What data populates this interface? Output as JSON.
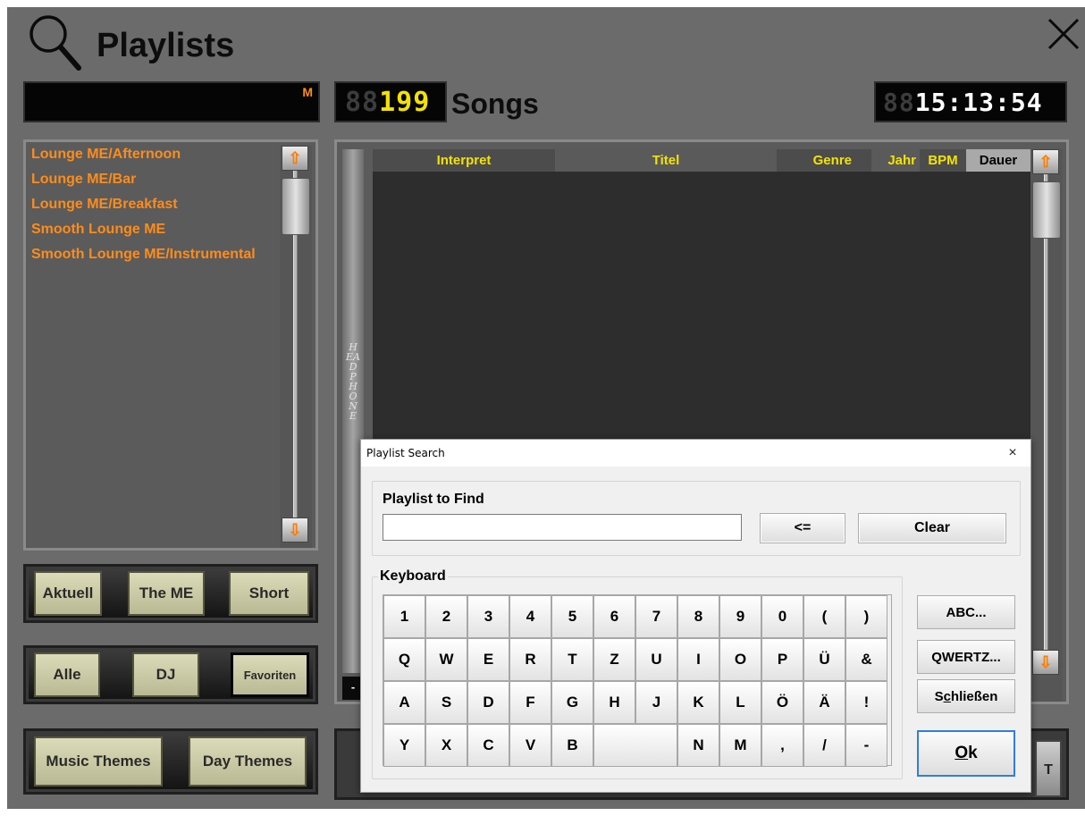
{
  "header": {
    "title": "Playlists",
    "search_indicator": "M",
    "song_count_off": "88",
    "song_count_on": "199",
    "songs_label": "Songs",
    "clock_off": "88",
    "clock_on": "15:13:54"
  },
  "playlists": [
    "Lounge ME/Afternoon",
    "Lounge ME/Bar",
    "Lounge ME/Breakfast",
    "Smooth Lounge ME",
    "Smooth Lounge ME/Instrumental"
  ],
  "filters": {
    "row1": [
      "Aktuell",
      "The ME",
      "Short"
    ],
    "row2": [
      "Alle",
      "DJ",
      "Favoriten"
    ],
    "row3": [
      "Music Themes",
      "Day Themes"
    ]
  },
  "song_table": {
    "columns": [
      "Interpret",
      "Titel",
      "Genre",
      "Jahr",
      "BPM",
      "Dauer"
    ]
  },
  "headphone_label": "HEADPHONE",
  "minus_label": "-",
  "bottom_tail_label": "T",
  "dialog": {
    "title": "Playlist Search",
    "close": "×",
    "find_label": "Playlist to Find",
    "find_value": "",
    "backspace_label": "<=",
    "clear_label": "Clear",
    "keyboard_label": "Keyboard",
    "keys": [
      [
        "1",
        "2",
        "3",
        "4",
        "5",
        "6",
        "7",
        "8",
        "9",
        "0",
        "(",
        ")"
      ],
      [
        "Q",
        "W",
        "E",
        "R",
        "T",
        "Z",
        "U",
        "I",
        "O",
        "P",
        "Ü",
        "&"
      ],
      [
        "A",
        "S",
        "D",
        "F",
        "G",
        "H",
        "J",
        "K",
        "L",
        "Ö",
        "Ä",
        "!"
      ],
      [
        "Y",
        "X",
        "C",
        "V",
        "B",
        " ",
        "N",
        "M",
        ",",
        "/",
        "-"
      ]
    ],
    "abc_label": "ABC...",
    "qwertz_label": "QWERTZ...",
    "close_btn_prefix": "S",
    "close_btn_underline": "c",
    "close_btn_suffix": "hließen",
    "ok_underline": "O",
    "ok_suffix": "k"
  },
  "colors": {
    "playlist_text": "#ff8c1a",
    "header_yellow": "#f3e200",
    "accent_blue": "#2f7de1"
  }
}
